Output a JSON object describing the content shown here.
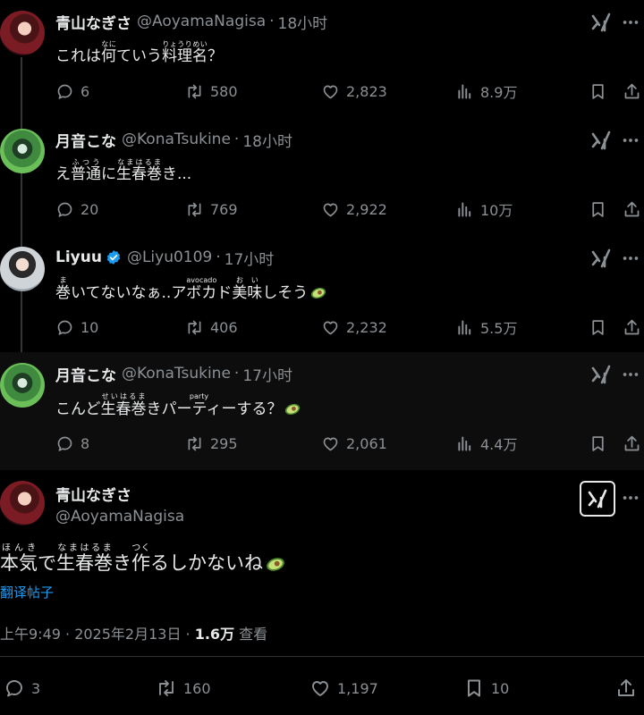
{
  "replies": [
    {
      "name": "青山なぎさ",
      "handle": "@AoyamaNagisa",
      "time": "18小时",
      "text_html": "これは<ruby>何<rt>なに</rt></ruby>ていう<ruby>料理名<rt>りょうりめい</rt></ruby>？",
      "stats": {
        "reply": "6",
        "retweet": "580",
        "like": "2,823",
        "views": "8.9万"
      }
    },
    {
      "name": "月音こな",
      "handle": "@KonaTsukine",
      "time": "18小时",
      "text_html": "え<ruby>普通<rt>ふつう</rt></ruby>に<ruby>生春巻<rt>なまはるま</rt></ruby>き...",
      "stats": {
        "reply": "20",
        "retweet": "769",
        "like": "2,922",
        "views": "10万"
      }
    },
    {
      "name": "Liyuu",
      "handle": "@Liyu0109",
      "time": "17小时",
      "text_html": "<ruby>巻<rt>ま</rt></ruby>いてないなぁ..<ruby>アボカド<rt>avocado</rt></ruby><ruby>美味<rt>おい</rt></ruby>しそう",
      "stats": {
        "reply": "10",
        "retweet": "406",
        "like": "2,232",
        "views": "5.5万"
      }
    },
    {
      "name": "月音こな",
      "handle": "@KonaTsukine",
      "time": "17小时",
      "text_html": "こんど<ruby>生春巻<rt>せいはるま</rt></ruby>き<ruby>パーティー<rt>party</rt></ruby>する？",
      "stats": {
        "reply": "8",
        "retweet": "295",
        "like": "2,061",
        "views": "4.4万"
      }
    }
  ],
  "main": {
    "name": "青山なぎさ",
    "handle": "@AoyamaNagisa",
    "text_html": "<ruby>本気<rt>ほんき</rt></ruby>で<ruby>生春巻<rt>なまはるま</rt></ruby>き<ruby>作<rt>つく</rt></ruby>るしかないね",
    "translate": "翻译帖子",
    "timestamp": "上午9:49 · 2025年2月13日 · ",
    "views_count": "1.6万",
    "views_label": " 查看",
    "stats": {
      "reply": "3",
      "retweet": "160",
      "like": "1,197",
      "bookmark": "10"
    }
  },
  "icons": {
    "reply": "reply-icon",
    "retweet": "retweet-icon",
    "like": "like-icon",
    "views": "views-icon",
    "bookmark": "bookmark-icon",
    "share": "share-icon",
    "grok": "grok-icon",
    "more": "more-icon",
    "verified": "verified-badge-icon",
    "avocado": "avocado-emoji"
  },
  "colors": {
    "background": "#000000",
    "text": "#e7e9ea",
    "secondary": "#8b9095",
    "link": "#1d9bf0",
    "verified": "#1d9bf0"
  }
}
